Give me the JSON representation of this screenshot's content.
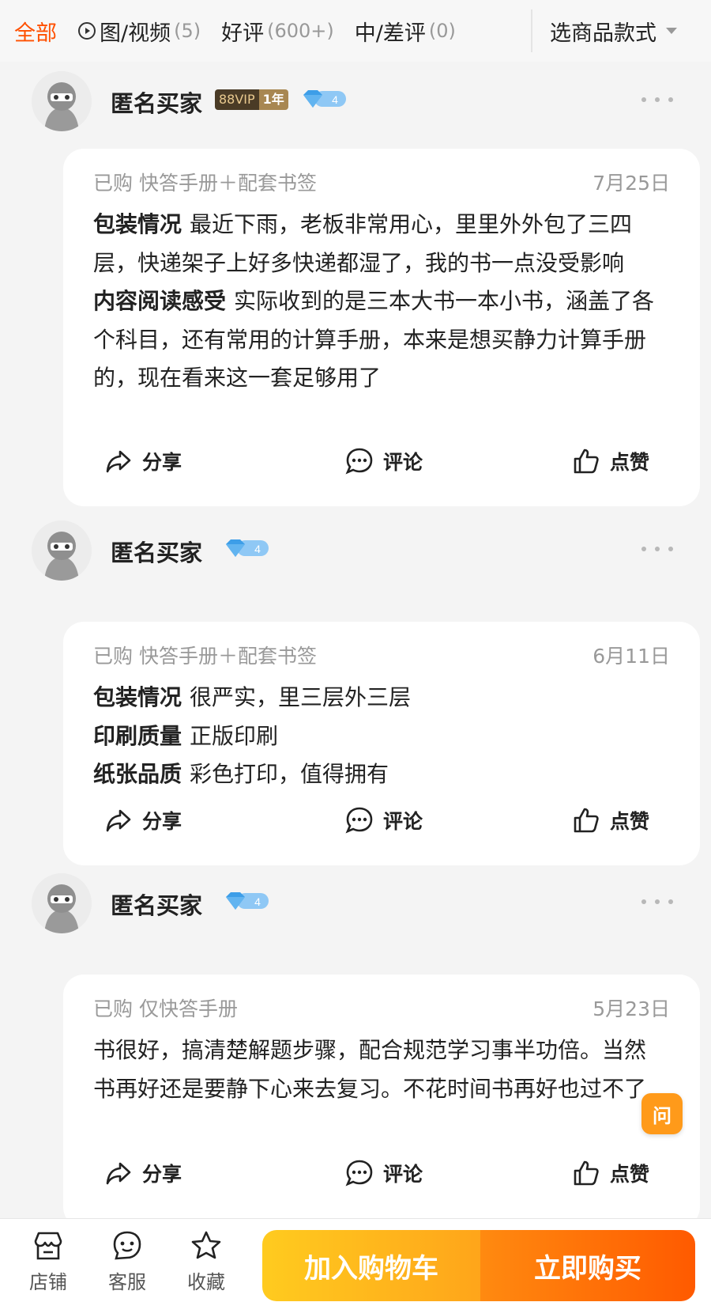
{
  "filters": {
    "all": "全部",
    "media": "图/视频",
    "media_count": "(5)",
    "positive": "好评",
    "positive_count": "(600+)",
    "negative": "中/差评",
    "negative_count": "(0)",
    "sku_select": "选商品款式"
  },
  "reviews": [
    {
      "name": "匿名买家",
      "vip": "88VIP",
      "vip_years": "1年",
      "level": "4",
      "purchased": "已购 快答手册＋配套书签",
      "date": "7月25日",
      "paragraphs": [
        {
          "label": "包装情况",
          "text": "最近下雨，老板非常用心，里里外外包了三四层，快递架子上好多快递都湿了，我的书一点没受影响"
        },
        {
          "label": "内容阅读感受",
          "text": "实际收到的是三本大书一本小书，涵盖了各个科目，还有常用的计算手册，本来是想买静力计算手册的，现在看来这一套足够用了"
        }
      ]
    },
    {
      "name": "匿名买家",
      "level": "4",
      "purchased": "已购 快答手册＋配套书签",
      "date": "6月11日",
      "paragraphs": [
        {
          "label": "包装情况",
          "text": "很严实，里三层外三层"
        },
        {
          "label": "印刷质量",
          "text": "正版印刷"
        },
        {
          "label": "纸张品质",
          "text": "彩色打印，值得拥有"
        }
      ]
    },
    {
      "name": "匿名买家",
      "level": "4",
      "purchased": "已购 仅快答手册",
      "date": "5月23日",
      "paragraphs": [
        {
          "label": "",
          "text": "书很好，搞清楚解题步骤，配合规范学习事半功倍。当然书再好还是要静下心来去复习。不花时间书再好也过不了"
        }
      ]
    }
  ],
  "actions": {
    "share": "分享",
    "comment": "评论",
    "like": "点赞"
  },
  "ask_label": "问",
  "bottom_bar": {
    "store": "店铺",
    "service": "客服",
    "favorite": "收藏",
    "add_to_cart": "加入购物车",
    "buy_now": "立即购买"
  },
  "colors": {
    "accent": "#ff5000",
    "cart_gradient": "#ffa51a",
    "buy_gradient": "#ff5a00"
  }
}
